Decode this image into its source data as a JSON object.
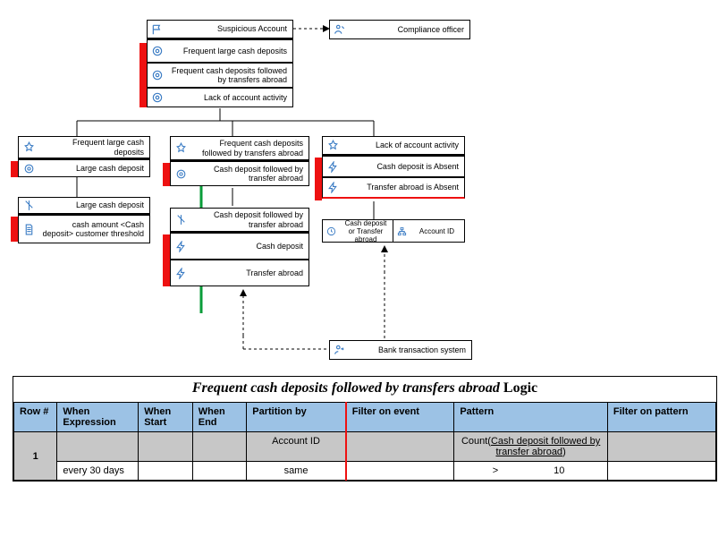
{
  "nodes": {
    "suspicious_account": "Suspicious Account",
    "compliance_officer": "Compliance officer",
    "frequent_large_cash": "Frequent large cash deposits",
    "frequent_cash_transfers": "Frequent cash deposits followed by transfers abroad",
    "lack_activity": "Lack of account activity",
    "left_header": "Frequent  large cash deposits",
    "large_cash_deposit": "Large cash deposit",
    "cash_amount_threshold": "cash amount <Cash deposit> customer threshold",
    "center_header": "Frequent cash deposits followed  by transfers abroad",
    "cash_deposit_transfer": "Cash deposit followed by transfer abroad",
    "cash_deposit_transfer2": "Cash deposit followed by transfer abroad",
    "cash_deposit": "Cash deposit",
    "transfer_abroad": "Transfer abroad",
    "right_header": "Lack of account activity",
    "cash_deposit_absent": "Cash deposit is Absent",
    "transfer_abroad_absent": "Transfer abroad is Absent",
    "half_left": "Cash deposit or Transfer abroad",
    "half_right": "Account ID",
    "bank_system": "Bank transaction system"
  },
  "table": {
    "title_italic": "Frequent cash deposits followed by transfers abroad",
    "title_rest": "Logic",
    "headers": [
      "Row #",
      "When Expression",
      "When Start",
      "When End",
      "Partition by",
      "Filter on event",
      "Pattern",
      "Filter on pattern"
    ],
    "grayrow": {
      "partition": "Account ID",
      "pattern_prefix": "Count(",
      "pattern_underline": "Cash deposit followed by transfer abroad",
      "pattern_suffix": ")"
    },
    "rows": [
      {
        "num": "1",
        "when_expr": "every 30 days",
        "partition": "same",
        "pattern_op": ">",
        "pattern_val": "10"
      }
    ]
  }
}
